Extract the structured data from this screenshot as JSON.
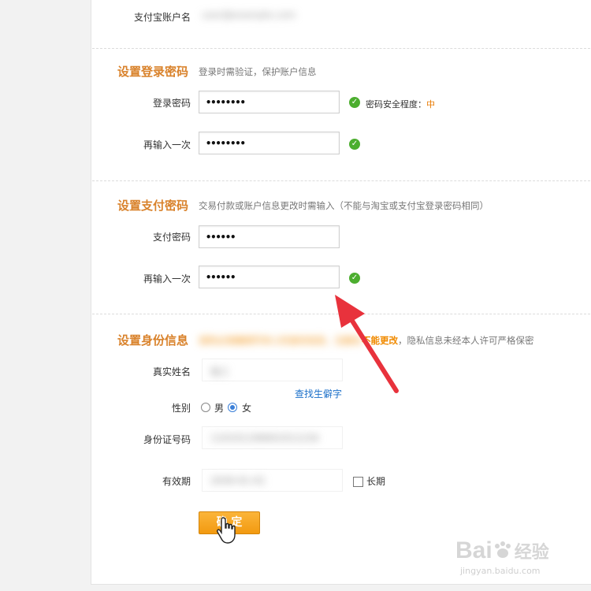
{
  "account": {
    "label": "支付宝账户名",
    "value": "user@example.com"
  },
  "login_section": {
    "title": "设置登录密码",
    "desc": "登录时需验证，保护账户信息",
    "password_label": "登录密码",
    "password_mask": "••••••••",
    "strength_label": "密码安全程度：",
    "strength_value": "中",
    "confirm_label": "再输入一次",
    "confirm_mask": "••••••••"
  },
  "pay_section": {
    "title": "设置支付密码",
    "desc": "交易付款或账户信息更改时需输入（不能与淘宝或支付宝登录密码相同）",
    "password_label": "支付密码",
    "password_mask": "••••••",
    "confirm_label": "再输入一次",
    "confirm_mask": "••••••"
  },
  "identity_section": {
    "title": "设置身份信息",
    "desc_hidden": "请务必准确填写本人的身份信息，注册后",
    "desc_warning": "不能更改",
    "desc_tail": "，隐私信息未经本人许可严格保密",
    "name_label": "真实姓名",
    "name_value": "张三",
    "rare_char_link": "查找生僻字",
    "gender_label": "性别",
    "gender_male": "男",
    "gender_female": "女",
    "gender_selected": "女",
    "id_label": "身份证号码",
    "id_value": "110101199001011234",
    "validity_label": "有效期",
    "validity_value": "2030-01-01",
    "longterm_label": "长期"
  },
  "submit_label": "确 定",
  "watermark": {
    "brand": "Bai",
    "brand2": "经验",
    "url": "jingyan.baidu.com"
  },
  "colors": {
    "accent": "#d9822b",
    "check": "#4cae2f",
    "link": "#1a6fc9",
    "arrow": "#e8323c",
    "button": "#f4a21c"
  }
}
